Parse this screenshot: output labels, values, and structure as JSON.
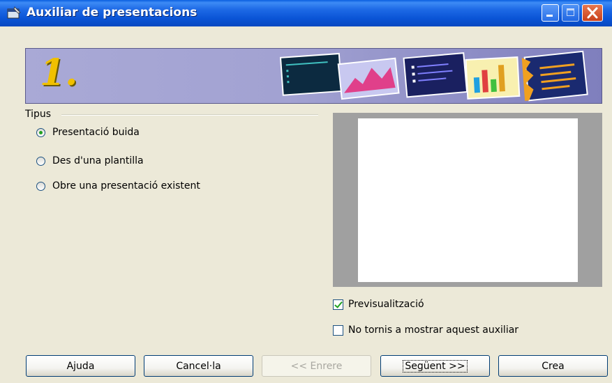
{
  "window": {
    "title": "Auxiliar de presentacions"
  },
  "banner": {
    "step_number": "1."
  },
  "type_group": {
    "label": "Tipus",
    "options": [
      {
        "label": "Presentació buida",
        "selected": true
      },
      {
        "label": "Des d'una plantilla",
        "selected": false
      },
      {
        "label": "Obre una presentació existent",
        "selected": false
      }
    ]
  },
  "preview_checkbox": {
    "label": "Previsualització",
    "checked": true
  },
  "no_show_checkbox": {
    "label": "No tornis a mostrar aquest auxiliar",
    "checked": false
  },
  "buttons": {
    "help": "Ajuda",
    "cancel": "Cancel·la",
    "back": "<< Enrere",
    "next": "Següent >>",
    "create": "Crea"
  },
  "colors": {
    "titlebar": "#0a54d6",
    "dialog_bg": "#ece9d8",
    "banner": "#a2a2d2",
    "step_number": "#f0c000",
    "radio_dot": "#21a121"
  }
}
